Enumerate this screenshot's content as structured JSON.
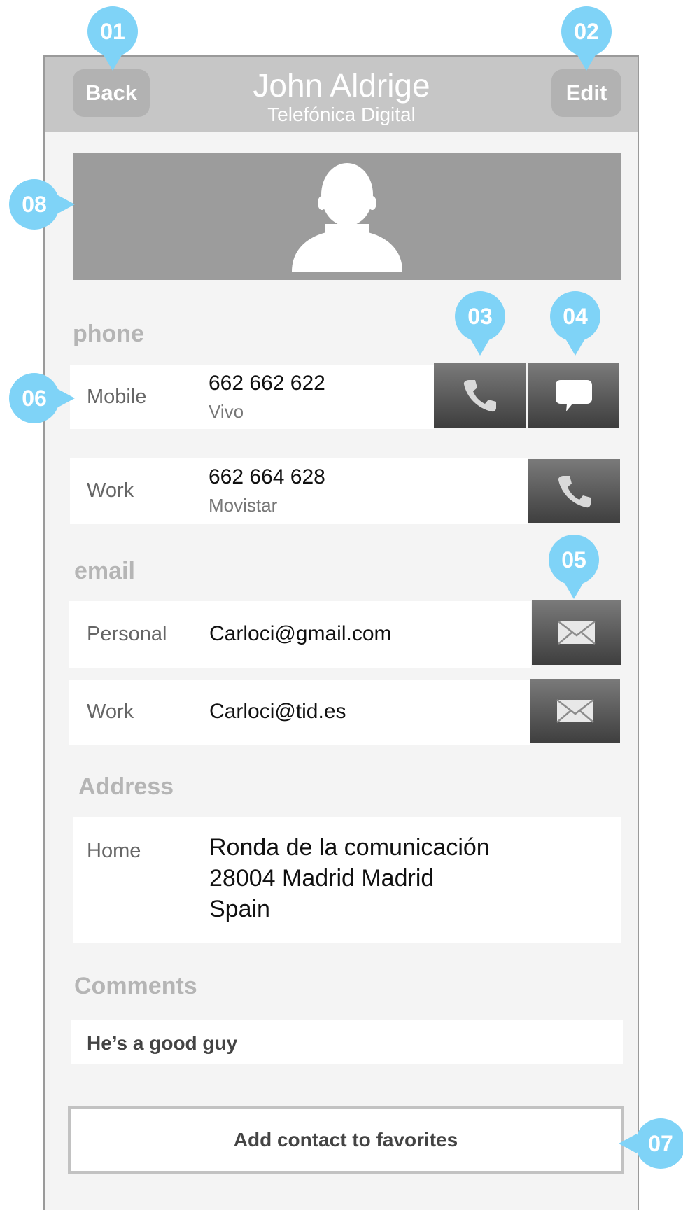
{
  "header": {
    "back_label": "Back",
    "edit_label": "Edit",
    "name": "John Aldrige",
    "company": "Telefónica Digital"
  },
  "sections": {
    "phone": "phone",
    "email": "email",
    "address": "Address",
    "comments": "Comments"
  },
  "phones": [
    {
      "label": "Mobile",
      "number": "662 662 622",
      "carrier": "Vivo"
    },
    {
      "label": "Work",
      "number": "662 664 628",
      "carrier": "Movistar"
    }
  ],
  "emails": [
    {
      "label": "Personal",
      "address": "Carloci@gmail.com"
    },
    {
      "label": "Work",
      "address": "Carloci@tid.es"
    }
  ],
  "address": {
    "label": "Home",
    "line1": "Ronda de la comunicación",
    "line2": "28004 Madrid Madrid",
    "line3": "Spain"
  },
  "comment": "He’s a good guy",
  "favorites_button": "Add contact to favorites",
  "annotations": {
    "a01": "01",
    "a02": "02",
    "a03": "03",
    "a04": "04",
    "a05": "05",
    "a06": "06",
    "a07": "07",
    "a08": "08"
  },
  "icons": {
    "call": "phone-icon",
    "message": "speech-bubble-icon",
    "mail": "envelope-icon",
    "avatar": "person-silhouette-icon"
  },
  "colors": {
    "annotation": "#7fd3f7",
    "header": "#c6c6c6",
    "photo_bg": "#9c9c9c"
  }
}
